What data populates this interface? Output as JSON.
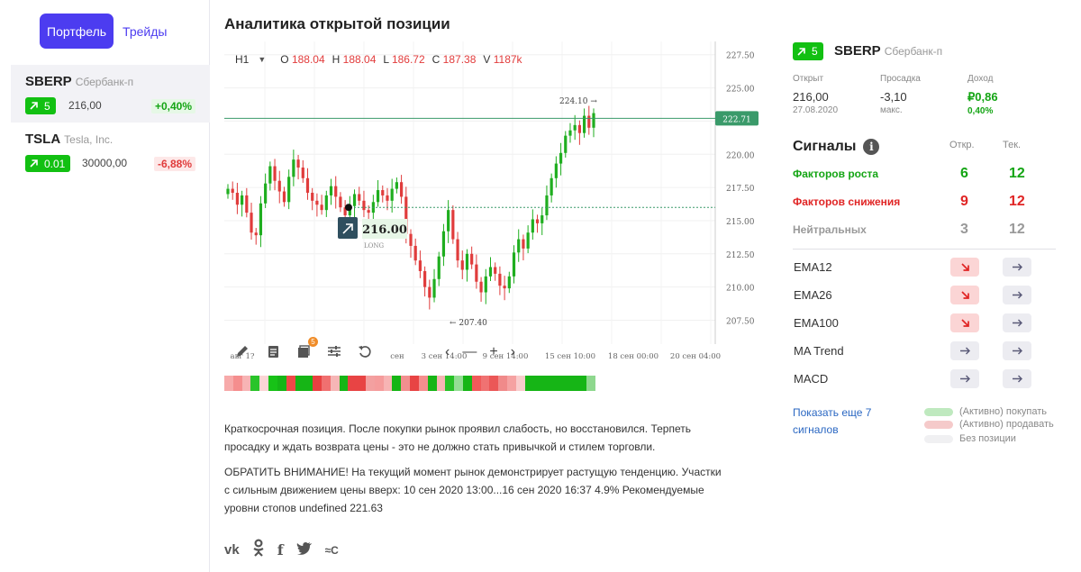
{
  "sidebar": {
    "tabs": {
      "active": "Портфель",
      "other": "Трейды"
    },
    "positions": [
      {
        "ticker": "SBERP",
        "name": "Сбербанк-п",
        "badge": "5",
        "price": "216,00",
        "change": "+0,40%",
        "direction": "up"
      },
      {
        "ticker": "TSLA",
        "name": "Tesla, Inc.",
        "badge": "0.01",
        "price": "30000,00",
        "change": "-6,88%",
        "direction": "down"
      }
    ]
  },
  "main": {
    "title": "Аналитика открытой позиции",
    "ohlc": {
      "interval": "H1",
      "o_label": "O",
      "o": "188.04",
      "h_label": "H",
      "h": "188.04",
      "l_label": "L",
      "l": "186.72",
      "c_label": "C",
      "c": "187.38",
      "v_label": "V",
      "v": "1187k"
    },
    "description": [
      "Краткосрочная позиция. После покупки рынок проявил слабость, но восстановился. Терпеть просадку и ждать возврата цены - это не должно стать привычкой и стилем торговли.",
      "ОБРАТИТЬ ВНИМАНИЕ! На текущий момент рынок демонстрирует растущую тенденцию. Участки с сильным движением цены вверх: 10 сен 2020 13:00...16 сен 2020 16:37 4.9% Рекомендуемые уровни стопов undefined 221.63"
    ],
    "toolbar_badge": "5",
    "socials": [
      "vk-icon",
      "ok-icon",
      "facebook-icon",
      "twitter-icon",
      "rc-icon"
    ]
  },
  "chart_data": {
    "type": "candlestick",
    "y_ticks": [
      "227.50",
      "225.00",
      "222.50",
      "220.00",
      "217.50",
      "215.00",
      "212.50",
      "210.00",
      "207.50"
    ],
    "ylim": [
      205.7,
      228.5
    ],
    "x_ticks": [
      "авг 1?",
      "сен",
      "3 сен 14:00",
      "9 сен 14:00",
      "15 сен 10:00",
      "18 сен 00:00",
      "20 сен 04:00"
    ],
    "current_price": "222.71",
    "entry_price": "216.00",
    "entry_label": "LONG",
    "max_label": "224.10",
    "min_label": "207.40",
    "close_series": [
      217.4,
      217.1,
      216.2,
      216.9,
      215.6,
      214.1,
      213.9,
      216.3,
      217.8,
      219.1,
      218.0,
      217.2,
      216.4,
      218.3,
      219.6,
      219.0,
      218.2,
      217.1,
      216.5,
      216.2,
      215.8,
      216.9,
      217.6,
      216.8,
      216.0,
      215.4,
      216.1,
      217.0,
      216.5,
      215.8,
      215.6,
      216.4,
      217.3,
      216.9,
      216.5,
      217.4,
      217.9,
      216.8,
      214.0,
      213.1,
      212.0,
      211.2,
      210.0,
      209.2,
      210.6,
      212.3,
      214.2,
      215.8,
      213.6,
      212.0,
      211.3,
      212.5,
      211.7,
      210.4,
      209.6,
      210.8,
      211.5,
      211.0,
      210.1,
      209.9,
      210.8,
      212.6,
      213.6,
      212.9,
      214.1,
      215.1,
      214.8,
      215.4,
      216.9,
      218.2,
      219.3,
      220.1,
      221.4,
      221.8,
      222.2,
      221.6,
      222.9,
      222.0,
      223.1
    ]
  },
  "heatmap": [
    "#f7aaaa",
    "#f58e8e",
    "#f7b4b4",
    "#2ac42a",
    "#fbd5d5",
    "#17c217",
    "#16b516",
    "#f04848",
    "#16b516",
    "#16b516",
    "#e84141",
    "#f07070",
    "#f6b6b6",
    "#16b516",
    "#e84444",
    "#e84444",
    "#f3a0a0",
    "#f59c9c",
    "#f7b4b4",
    "#16b516",
    "#f28f8f",
    "#e84444",
    "#f58e8e",
    "#16b516",
    "#f7b4b4",
    "#27c227",
    "#94dd94",
    "#16b516",
    "#f05a5a",
    "#f07272",
    "#eb5757",
    "#f08a8a",
    "#f5a2a2",
    "#f9cccc",
    "#16b516",
    "#16b516",
    "#16b516",
    "#16b516",
    "#16b516",
    "#16b516",
    "#16b516",
    "#8ed88e"
  ],
  "right": {
    "badge": "5",
    "ticker": "SBERP",
    "name": "Сбербанк-п",
    "stats": {
      "open_label": "Открыт",
      "open_val": "216,00",
      "open_sub": "27.08.2020",
      "dd_label": "Просадка",
      "dd_val": "-3,10",
      "dd_sub": "макс.",
      "inc_label": "Доход",
      "inc_val": "₽0,86",
      "inc_sub": "0,40%"
    },
    "signals_title": "Сигналы",
    "col_open": "Откр.",
    "col_cur": "Тек.",
    "groups": [
      {
        "label": "Факторов роста",
        "open": "6",
        "cur": "12",
        "color": "#14a514"
      },
      {
        "label": "Факторов снижения",
        "open": "9",
        "cur": "12",
        "color": "#e02424"
      },
      {
        "label": "Нейтральных",
        "open": "3",
        "cur": "12",
        "color": "#999999"
      }
    ],
    "indicators": [
      {
        "name": "EMA12",
        "open": "down",
        "cur": "neutral"
      },
      {
        "name": "EMA26",
        "open": "down",
        "cur": "neutral"
      },
      {
        "name": "EMA100",
        "open": "down",
        "cur": "neutral"
      },
      {
        "name": "MA Trend",
        "open": "neutral",
        "cur": "neutral"
      },
      {
        "name": "MACD",
        "open": "neutral",
        "cur": "neutral"
      }
    ],
    "more_link": "Показать еще 7 сигналов",
    "legend": [
      {
        "label": "(Активно) покупать",
        "color": "#bfe9bf"
      },
      {
        "label": "(Активно) продавать",
        "color": "#f5caca"
      },
      {
        "label": "Без позиции",
        "color": "#f0f0f2"
      }
    ]
  }
}
